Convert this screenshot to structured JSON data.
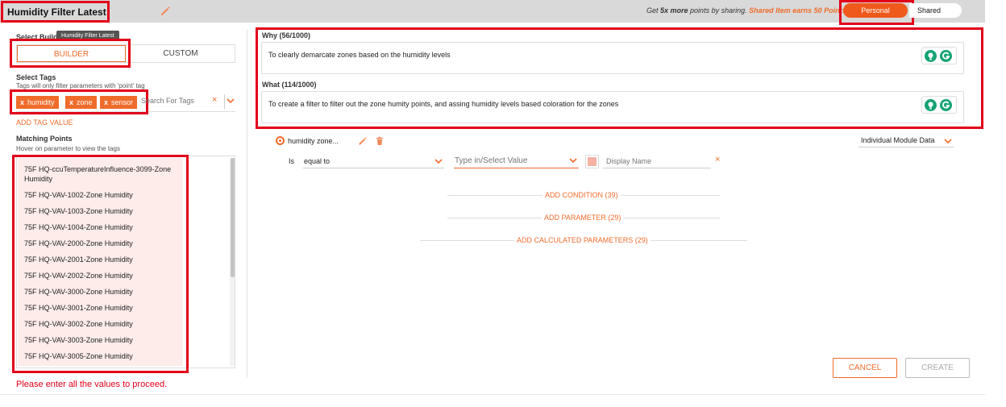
{
  "header": {
    "title": "Humidity Filter Latest",
    "promo_prefix": "Get ",
    "promo_bold": "5x more",
    "promo_mid": " points by sharing. ",
    "promo_accent": "Shared Item earns 50 Points.",
    "toggle": {
      "personal": "Personal",
      "shared": "Shared",
      "selected": "Personal"
    }
  },
  "left": {
    "select_build_label": "Select Build",
    "tooltip": "Humidity Filter Latest",
    "builder_tab": "BUILDER",
    "custom_tab": "CUSTOM",
    "select_tags_label": "Select Tags",
    "tags_hint": "Tags will only filter parameters with 'point' tag",
    "tags": [
      "humidity",
      "zone",
      "sensor"
    ],
    "tag_remove_glyph": "x",
    "clear_glyph": "×",
    "search_placeholder": "Search For Tags",
    "add_tag_value": "ADD TAG VALUE",
    "matching_points_label": "Matching Points",
    "matching_points_hint": "Hover on parameter to view the tags",
    "points": [
      "75F HQ-ccuTemperatureInfluence-3099-Zone Humidity",
      "75F HQ-VAV-1002-Zone Humidity",
      "75F HQ-VAV-1003-Zone Humidity",
      "75F HQ-VAV-1004-Zone Humidity",
      "75F HQ-VAV-2000-Zone Humidity",
      "75F HQ-VAV-2001-Zone Humidity",
      "75F HQ-VAV-2002-Zone Humidity",
      "75F HQ-VAV-3000-Zone Humidity",
      "75F HQ-VAV-3001-Zone Humidity",
      "75F HQ-VAV-3002-Zone Humidity",
      "75F HQ-VAV-3003-Zone Humidity",
      "75F HQ-VAV-3005-Zone Humidity"
    ],
    "error": "Please enter all the values to proceed."
  },
  "right": {
    "why_label": "Why (56/1000)",
    "why_text": "To  clearly demarcate zones based on the humidity levels",
    "what_label": "What (114/1000)",
    "what_text": "To create a filter to filter out the zone humity points, and assing humidity levels based coloration for the zones",
    "parameter": {
      "name": "humidity zone...",
      "module_select": "Individual Module Data",
      "is_label": "Is",
      "operator": "equal to",
      "value_placeholder": "Type in/Select Value",
      "display_name_placeholder": "Display Name",
      "swatch_color": "#f4b1a4",
      "remove_glyph": "×"
    },
    "add_condition": "ADD CONDITION (39)",
    "add_parameter": "ADD PARAMETER (29)",
    "add_calculated": "ADD CALCULATED PARAMETERS (29)",
    "cancel": "CANCEL",
    "create": "CREATE"
  },
  "colors": {
    "accent": "#ef6c2b",
    "highlight": "#e2001a",
    "personal": "#ef5a1c",
    "grammarly": "#15a374"
  }
}
